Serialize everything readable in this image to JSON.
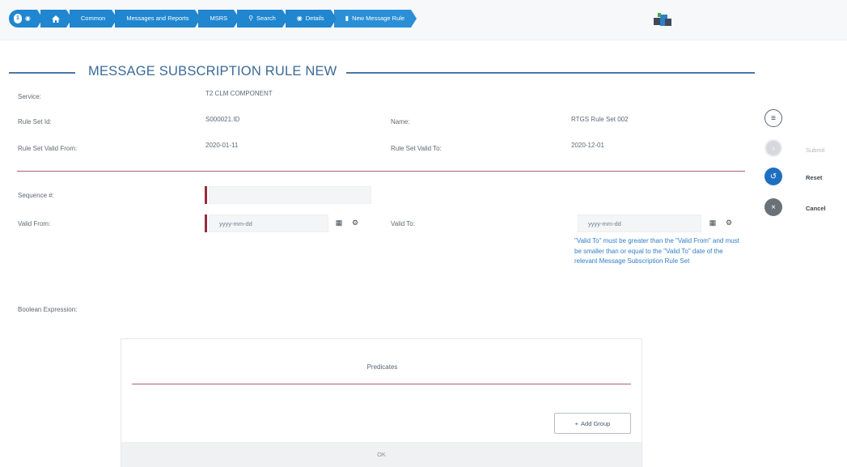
{
  "breadcrumb": {
    "user_badge": "1",
    "items": [
      "Common",
      "Messages and Reports",
      "MSRS",
      "Search",
      "Details",
      "New Message Rule"
    ]
  },
  "page": {
    "title": "MESSAGE SUBSCRIPTION RULE NEW"
  },
  "header_fields": {
    "service_label": "Service:",
    "service_value": "T2 CLM COMPONENT",
    "rule_set_id_label": "Rule Set Id:",
    "rule_set_id_value": "S000021.ID",
    "name_label": "Name:",
    "name_value": "RTGS Rule Set 002",
    "valid_from_label": "Rule Set Valid From:",
    "valid_from_value": "2020-01-11",
    "valid_to_label": "Rule Set Valid To:",
    "valid_to_value": "2020-12-01"
  },
  "form": {
    "sequence_label": "Sequence #:",
    "sequence_value": "",
    "valid_from_label": "Valid From:",
    "valid_from_placeholder": "yyyy-mm-dd",
    "valid_to_label": "Valid To:",
    "valid_to_placeholder": "yyyy-mm-dd",
    "valid_to_hint": "\"Valid To\" must be greater than the \"Valid From\" and must be smaller than or equal to the \"Valid To\" date of the relevant Message Subscription Rule Set",
    "boolean_label": "Boolean Expression:"
  },
  "actions": {
    "submit_label": "Submit",
    "reset_label": "Reset",
    "cancel_label": "Cancel"
  },
  "predicates": {
    "title": "Predicates",
    "add_group_label": "Add Group",
    "ok_label": "OK"
  },
  "colors": {
    "breadcrumb_blue": "#1f86cf",
    "title_blue": "#3b6a97",
    "required_marker": "#9c2a3c",
    "hint_text": "#2f7fc8",
    "reset_button": "#1f6fc0",
    "cancel_button": "#6b7178"
  }
}
